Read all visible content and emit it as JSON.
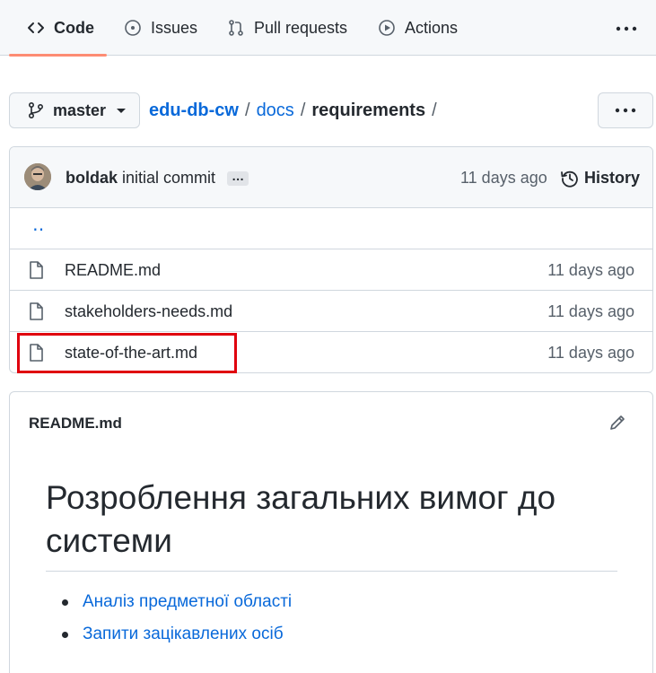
{
  "nav": {
    "tabs": [
      {
        "label": "Code",
        "icon": "code-icon",
        "active": true
      },
      {
        "label": "Issues",
        "icon": "issue-opened-icon"
      },
      {
        "label": "Pull requests",
        "icon": "git-pull-request-icon"
      },
      {
        "label": "Actions",
        "icon": "play-icon"
      }
    ],
    "accent": "#fd8c73"
  },
  "branch": {
    "label": "master"
  },
  "breadcrumb": {
    "repo": "edu-db-cw",
    "sep": "/",
    "folder": "docs",
    "current": "requirements"
  },
  "commit": {
    "author": "boldak",
    "message": "initial commit",
    "ellipsis": "…",
    "age": "11 days ago",
    "history_label": "History"
  },
  "files": {
    "parent": "‥",
    "items": [
      {
        "name": "README.md",
        "age": "11 days ago"
      },
      {
        "name": "stakeholders-needs.md",
        "age": "11 days ago"
      },
      {
        "name": "state-of-the-art.md",
        "age": "11 days ago",
        "highlighted": true
      }
    ]
  },
  "readme": {
    "filename": "README.md",
    "heading": "Розроблення загальних вимог до системи",
    "links": [
      "Аналіз предметної області",
      "Запити зацікавлених осіб"
    ]
  },
  "colors": {
    "link": "#0969da",
    "highlight": "#e0000e",
    "border": "#d0d7de"
  }
}
